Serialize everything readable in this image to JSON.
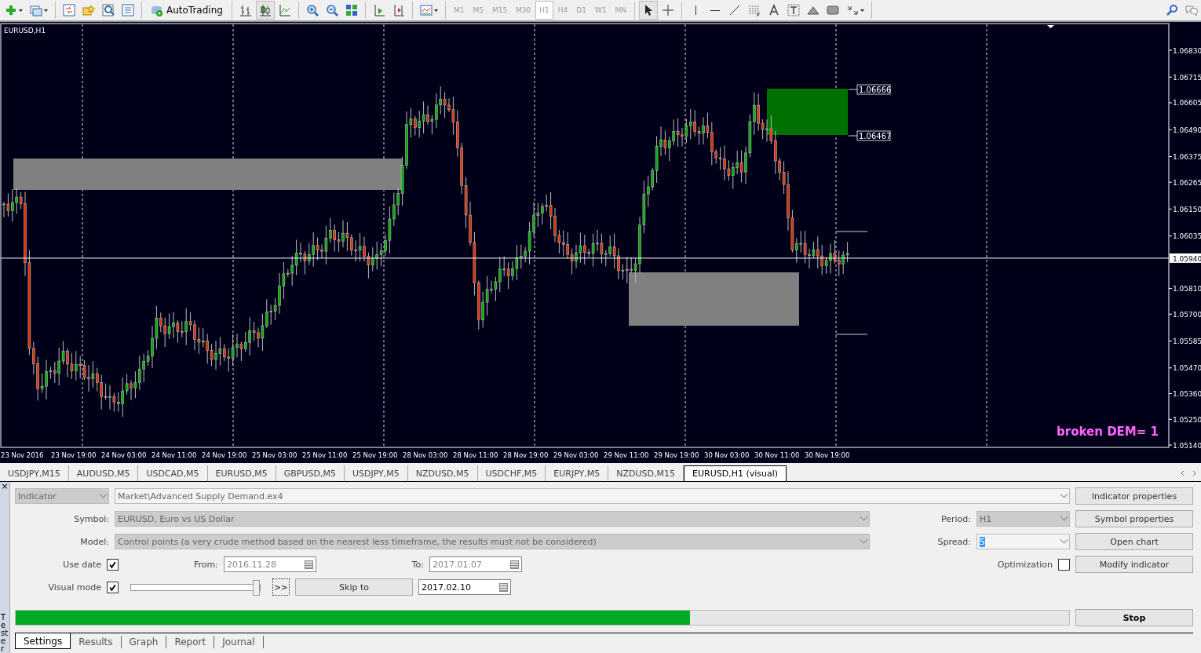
{
  "toolbar": {
    "autotrading": "AutoTrading",
    "timeframes": [
      {
        "label": "M1",
        "selected": false
      },
      {
        "label": "M5",
        "selected": false
      },
      {
        "label": "M15",
        "selected": false
      },
      {
        "label": "M30",
        "selected": false
      },
      {
        "label": "H1",
        "selected": true
      },
      {
        "label": "H4",
        "selected": false
      },
      {
        "label": "D1",
        "selected": false
      },
      {
        "label": "W1",
        "selected": false
      },
      {
        "label": "MN",
        "selected": false
      }
    ]
  },
  "chart": {
    "title": "EURUSD,H1",
    "price_ticks": [
      "1.06830",
      "1.06715",
      "1.06605",
      "1.06490",
      "1.06375",
      "1.06265",
      "1.06150",
      "1.06035",
      "1.05810",
      "1.05700",
      "1.05585",
      "1.05470",
      "1.05360",
      "1.05250",
      "1.05140"
    ],
    "current_price": "1.05940",
    "zone_labels": [
      "1.06666",
      "1.06467"
    ],
    "indicator_text": "broken DEM= 1",
    "time_labels": [
      "23 Nov 2016",
      "23 Nov 19:00",
      "24 Nov 03:00",
      "24 Nov 11:00",
      "24 Nov 19:00",
      "25 Nov 03:00",
      "25 Nov 11:00",
      "25 Nov 19:00",
      "28 Nov 03:00",
      "28 Nov 11:00",
      "28 Nov 19:00",
      "29 Nov 03:00",
      "29 Nov 11:00",
      "29 Nov 19:00",
      "30 Nov 03:00",
      "30 Nov 11:00",
      "30 Nov 19:00"
    ]
  },
  "symbol_tabs": [
    {
      "label": "USDJPY,M15",
      "selected": false
    },
    {
      "label": "AUDUSD,M5",
      "selected": false
    },
    {
      "label": "USDCAD,M5",
      "selected": false
    },
    {
      "label": "EURUSD,M5",
      "selected": false
    },
    {
      "label": "GBPUSD,M5",
      "selected": false
    },
    {
      "label": "USDJPY,M5",
      "selected": false
    },
    {
      "label": "NZDUSD,M5",
      "selected": false
    },
    {
      "label": "USDCHF,M5",
      "selected": false
    },
    {
      "label": "EURJPY,M5",
      "selected": false
    },
    {
      "label": "NZDUSD,M15",
      "selected": false
    },
    {
      "label": "EURUSD,H1 (visual)",
      "selected": true
    }
  ],
  "tester": {
    "side_label": "Tester",
    "close": "×",
    "mode": "Indicator",
    "file": "Market\\Advanced Supply Demand.ex4",
    "symbol_label": "Symbol:",
    "symbol": "EURUSD, Euro vs US Dollar",
    "period_label": "Period:",
    "period": "H1",
    "model_label": "Model:",
    "model": "Control points (a very crude method based on the nearest less timeframe, the results must not be considered)",
    "spread_label": "Spread:",
    "spread": "5",
    "use_date_label": "Use date",
    "use_date": true,
    "from_label": "From:",
    "from": "2016.11.28",
    "to_label": "To:",
    "to": "2017.01.07",
    "optimization_label": "Optimization",
    "optimization": false,
    "visual_label": "Visual mode",
    "visual": true,
    "speed": {
      "level": 1
    },
    "skip_button": ">>",
    "skip_to": "Skip to",
    "skip_date": "2017.02.10",
    "buttons": [
      "Indicator properties",
      "Symbol properties",
      "Open chart",
      "Modify indicator"
    ],
    "progress": {
      "level": 0.64
    },
    "stop": "Stop",
    "tabs": [
      {
        "label": "Settings",
        "selected": true
      },
      {
        "label": "Results",
        "selected": false
      },
      {
        "label": "Graph",
        "selected": false
      },
      {
        "label": "Report",
        "selected": false
      },
      {
        "label": "Journal",
        "selected": false
      }
    ]
  }
}
